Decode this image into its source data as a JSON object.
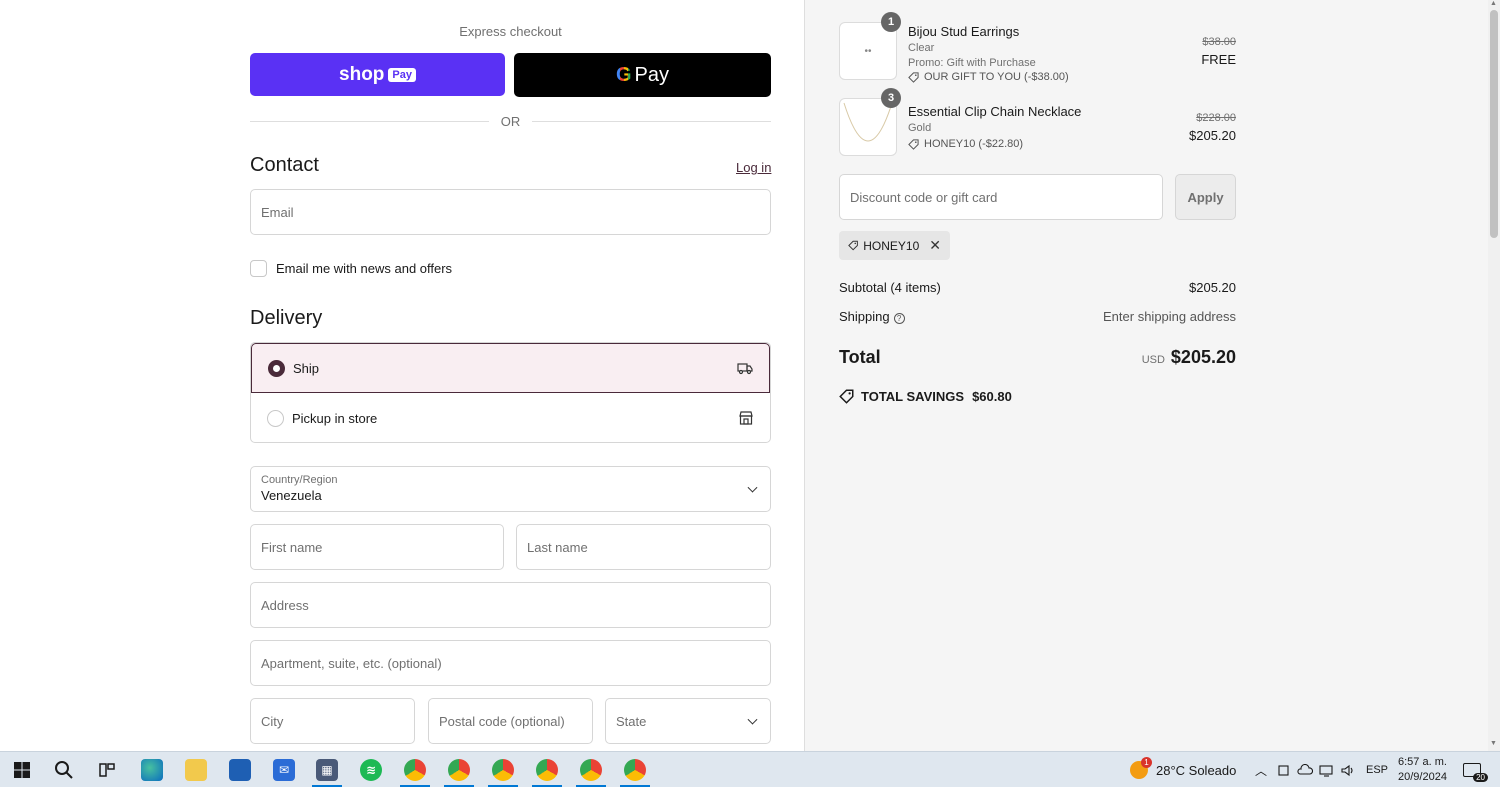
{
  "express": {
    "title": "Express checkout",
    "shop_pay_label": "shop",
    "shop_pay_chip": "Pay",
    "gpay_g": "G",
    "gpay_label": "Pay",
    "or_label": "OR"
  },
  "contact": {
    "heading": "Contact",
    "login_link": "Log in",
    "email_placeholder": "Email",
    "newsletter_label": "Email me with news and offers"
  },
  "delivery": {
    "heading": "Delivery",
    "options": [
      {
        "label": "Ship",
        "selected": true,
        "icon": "truck-icon"
      },
      {
        "label": "Pickup in store",
        "selected": false,
        "icon": "store-icon"
      }
    ],
    "country_label": "Country/Region",
    "country_value": "Venezuela",
    "first_name_placeholder": "First name",
    "last_name_placeholder": "Last name",
    "address_placeholder": "Address",
    "apartment_placeholder": "Apartment, suite, etc. (optional)",
    "city_placeholder": "City",
    "postal_placeholder": "Postal code (optional)",
    "state_placeholder": "State"
  },
  "cart": {
    "items": [
      {
        "qty": "1",
        "name": "Bijou Stud Earrings",
        "variant": "Clear",
        "promo": "Promo: Gift with Purchase",
        "discount": "OUR GIFT TO YOU (-$38.00)",
        "price_old": "$38.00",
        "price_new": "FREE"
      },
      {
        "qty": "3",
        "name": "Essential Clip Chain Necklace",
        "variant": "Gold",
        "discount": "HONEY10 (-$22.80)",
        "price_old": "$228.00",
        "price_new": "$205.20"
      }
    ],
    "discount_placeholder": "Discount code or gift card",
    "apply_label": "Apply",
    "applied_code": "HONEY10",
    "subtotal_label": "Subtotal (4 items)",
    "subtotal_value": "$205.20",
    "shipping_label": "Shipping",
    "shipping_value": "Enter shipping address",
    "total_label": "Total",
    "total_currency": "USD",
    "total_value": "$205.20",
    "savings_label": "TOTAL SAVINGS",
    "savings_value": "$60.80"
  },
  "taskbar": {
    "weather": "28°C  Soleado",
    "weather_badge": "1",
    "language": "ESP",
    "time": "6:57 a. m.",
    "date": "20/9/2024",
    "notifications": "20"
  }
}
